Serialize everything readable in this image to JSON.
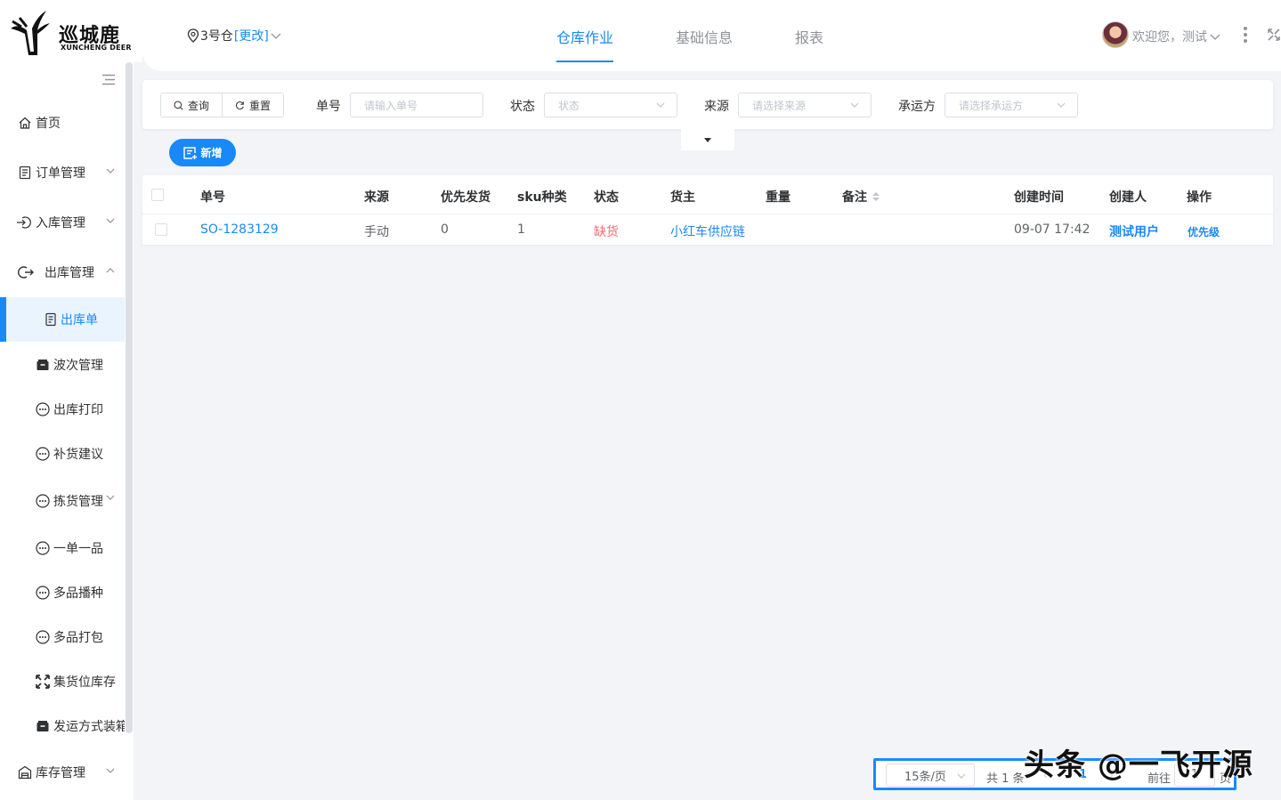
{
  "logo": {
    "name_cn": "巡城鹿",
    "name_en": "XUNCHENG DEER"
  },
  "header": {
    "warehouse": "3号仓",
    "change_label": "[更改]",
    "tabs": [
      {
        "label": "仓库作业",
        "active": true
      },
      {
        "label": "基础信息",
        "active": false
      },
      {
        "label": "报表",
        "active": false
      }
    ],
    "welcome": "欢迎您，测试"
  },
  "sidebar": {
    "items": [
      {
        "label": "首页",
        "icon": "home-icon"
      },
      {
        "label": "订单管理",
        "icon": "order-icon"
      },
      {
        "label": "入库管理",
        "icon": "inbound-icon"
      },
      {
        "label": "出库管理",
        "icon": "outbound-icon"
      },
      {
        "label": "出库单",
        "icon": "doc-icon",
        "active": true
      },
      {
        "label": "波次管理",
        "icon": "box-icon"
      },
      {
        "label": "出库打印",
        "icon": "dots-icon"
      },
      {
        "label": "补货建议",
        "icon": "dots-icon"
      },
      {
        "label": "拣货管理",
        "icon": "dots-icon"
      },
      {
        "label": "一单一品",
        "icon": "dots-icon"
      },
      {
        "label": "多品播种",
        "icon": "dots-icon"
      },
      {
        "label": "多品打包",
        "icon": "dots-icon"
      },
      {
        "label": "集货位库存",
        "icon": "collect-icon"
      },
      {
        "label": "发运方式装箱",
        "icon": "box-icon"
      },
      {
        "label": "库存管理",
        "icon": "stock-icon"
      }
    ]
  },
  "search": {
    "query_label": "查询",
    "reset_label": "重置",
    "order_no_label": "单号",
    "order_no_placeholder": "请输入单号",
    "status_label": "状态",
    "status_placeholder": "状态",
    "source_label": "来源",
    "source_placeholder": "请选择来源",
    "carrier_label": "承运方",
    "carrier_placeholder": "请选择承运方"
  },
  "add_label": "新增",
  "table": {
    "columns": [
      "单号",
      "来源",
      "优先发货",
      "sku种类",
      "状态",
      "货主",
      "重量",
      "备注",
      "创建时间",
      "创建人",
      "操作"
    ],
    "rows": [
      {
        "order_no": "SO-1283129",
        "source": "手动",
        "priority": "0",
        "sku_count": "1",
        "status": "缺货",
        "owner": "小红车供应链",
        "weight": "",
        "remark": "",
        "created_at": "09-07 17:42",
        "creator": "测试用户",
        "action": "优先级"
      }
    ]
  },
  "pagination": {
    "page_size": "15条/页",
    "total": "共 1 条",
    "current_page": "1",
    "goto_label": "前往",
    "goto_value": "1",
    "page_suffix": "页"
  },
  "watermark": "头条 @一飞开源",
  "colors": {
    "primary": "#1989fa",
    "danger": "#f56c6c"
  }
}
